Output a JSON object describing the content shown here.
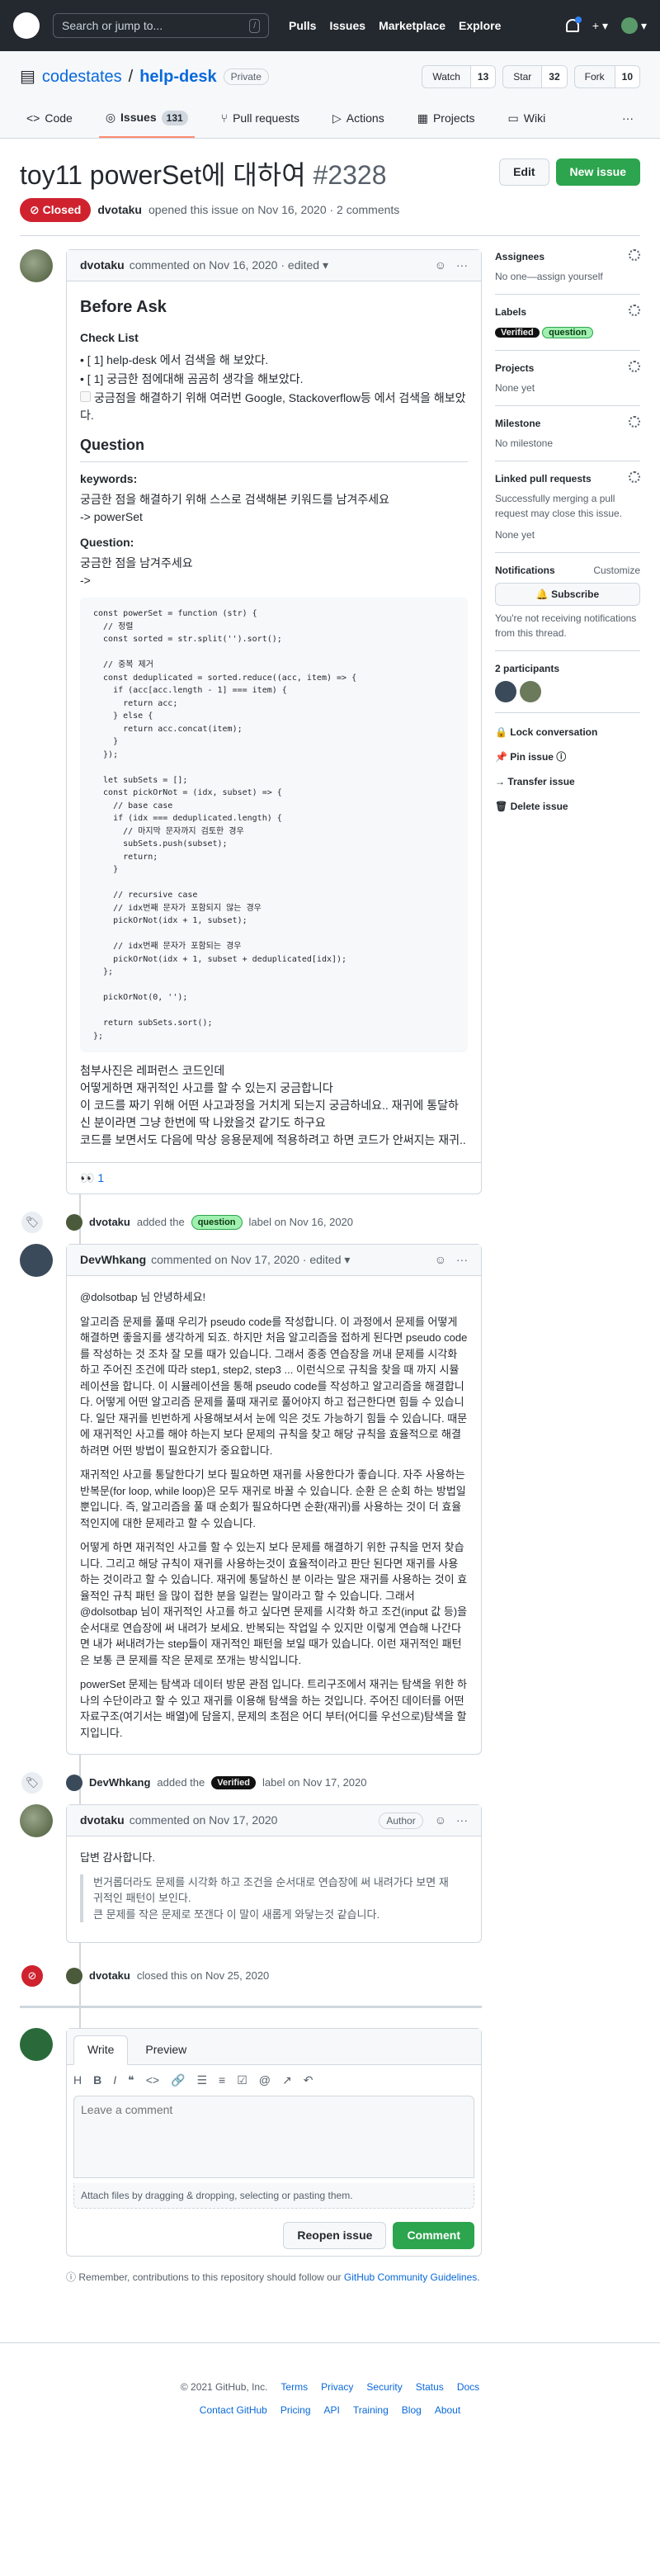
{
  "header": {
    "search_placeholder": "Search or jump to...",
    "search_key": "/",
    "nav": [
      "Pulls",
      "Issues",
      "Marketplace",
      "Explore"
    ],
    "plus": "+ ▾",
    "avatar_caret": "▾"
  },
  "repo": {
    "owner": "codestates",
    "sep": " / ",
    "name": "help-desk",
    "visibility": "Private",
    "watch": "Watch",
    "watch_count": "13",
    "star": "Star",
    "star_count": "32",
    "fork": "Fork",
    "fork_count": "10"
  },
  "tabs": {
    "code": "Code",
    "issues": "Issues",
    "issues_count": "131",
    "pulls": "Pull requests",
    "actions": "Actions",
    "projects": "Projects",
    "wiki": "Wiki",
    "more": "···"
  },
  "issue": {
    "title": "toy11 powerSet에 대하여",
    "number": "#2328",
    "edit": "Edit",
    "new_issue": "New issue",
    "state": "Closed",
    "author": "dvotaku",
    "opened": "opened this issue on Nov 16, 2020 · 2 comments"
  },
  "c1": {
    "author": "dvotaku",
    "meta": "commented on Nov 16, 2020 · edited ▾",
    "h_before": "Before Ask",
    "h_check": "Check List",
    "check1": "[ 1] help-desk 에서 검색을 해 보았다.",
    "check2": "[ 1] 궁금한 점에대해 곰곰히 생각을 해보았다.",
    "check3": "궁금점을 해결하기 위해 여러번 Google, Stackoverflow등 에서 검색을 해보았다.",
    "h_question": "Question",
    "keywords_h": "keywords:",
    "keywords_p1": "궁금한 점을 해결하기 위해 스스로 검색해본 키워드를 남겨주세요",
    "keywords_p2": "-> powerSet",
    "question_h": "Question:",
    "question_p1": "궁금한 점을 남겨주세요",
    "question_p2": "->",
    "code": "const powerSet = function (str) {\n  // 정렬\n  const sorted = str.split('').sort();\n\n  // 중복 제거\n  const deduplicated = sorted.reduce((acc, item) => {\n    if (acc[acc.length - 1] === item) {\n      return acc;\n    } else {\n      return acc.concat(item);\n    }\n  });\n\n  let subSets = [];\n  const pickOrNot = (idx, subset) => {\n    // base case\n    if (idx === deduplicated.length) {\n      // 마지막 문자까지 검토한 경우\n      subSets.push(subset);\n      return;\n    }\n\n    // recursive case\n    // idx번째 문자가 포함되지 않는 경우\n    pickOrNot(idx + 1, subset);\n\n    // idx번째 문자가 포함되는 경우\n    pickOrNot(idx + 1, subset + deduplicated[idx]);\n  };\n\n  pickOrNot(0, '');\n\n  return subSets.sort();\n};",
    "after1": "첨부사진은 레퍼런스 코드인데",
    "after2": "어떻게하면 재귀적인 사고를 할 수 있는지 궁금합니다",
    "after3": "이 코드를 짜기 위해 어떤 사고과정을 거치게 되는지 궁금하네요.. 재귀에 통달하신 분이라면 그냥 한번에 딱 나왔을것 같기도 하구요",
    "after4": "코드를 보면서도 다음에 막상 응용문제에 적용하려고 하면 코드가 안써지는 재귀..",
    "reaction": "👀 1"
  },
  "ev1": {
    "user": "dvotaku",
    "text1": "added the",
    "label": "question",
    "text2": "label on Nov 16, 2020"
  },
  "c2": {
    "author": "DevWhkang",
    "meta": "commented on Nov 17, 2020 · edited ▾",
    "p1": "@dolsotbap 님 안녕하세요!",
    "p2": "알고리즘 문제를 풀때 우리가 pseudo code를 작성합니다. 이 과정에서 문제를 어떻게 해결하면 좋을지를 생각하게 되죠. 하지만 처음 알고리즘을 접하게 된다면 pseudo code를 작성하는 것 조차 잘 모를 때가 있습니다. 그래서 종종 연습장을 꺼내 문제를 시각화 하고 주어진 조건에 따라 step1, step2, step3 ... 이런식으로 규칙을 찾을 때 까지 시뮬레이션을 합니다. 이 시뮬레이션을 통해 pseudo code를 작성하고 알고리즘을 해결합니다. 어떻게 어떤 알고리즘 문제를 풀때 재귀로 풀어야지 하고 접근한다면 힘들 수 있습니다. 일단 재귀를 빈번하게 사용해보셔서 눈에 익은 것도 가능하기 힘들 수 있습니다. 때문에 재귀적인 사고를 해야 하는지 보다 문제의 규칙을 찾고 해당 규칙을 효율적으로 해결하려면 어떤 방법이 필요한지가 중요합니다.",
    "p3": "재귀적인 사고를 통달한다기 보다 필요하면 재귀를 사용한다가 좋습니다. 자주 사용하는 반복문(for loop, while loop)은 모두 재귀로 바꿀 수 있습니다. 순환 은 순회 하는 방법일 뿐입니다. 즉, 알고리즘을 풀 때 순회가 필요하다면 순환(재귀)를 사용하는 것이 더 효율적인지에 대한 문제라고 할 수 있습니다.",
    "p4": "어떻게 하면 재귀적인 사고를 할 수 있는지 보다 문제를 해결하기 위한 규칙을 먼저 찾습니다. 그리고 해당 규칙이 재귀를 사용하는것이 효율적이라고 판단 된다면 재귀를 사용하는 것이라고 할 수 있습니다. 재귀에 통달하신 분 이라는 말은 재귀를 사용하는 것이 효율적인 규칙 패턴 을 많이 접한 분을 일컫는 말이라고 할 수 있습니다. 그래서 @dolsotbap 님이 재귀적인 사고를 하고 싶다면 문제를 시각화 하고 조건(input 값 등)을 순서대로 연습장에 써 내려가 보세요. 반복되는 작업일 수 있지만 이렇게 연습해 나간다면 내가 써내려가는 step들이 재귀적인 패턴을 보일 때가 있습니다. 이런 재귀적인 패턴은 보통 큰 문제를 작은 문제로 쪼개는 방식입니다.",
    "p5": "powerSet 문제는 탐색과 데이터 방문 관점 입니다. 트리구조에서 재귀는 탐색을 위한 하나의 수단이라고 할 수 있고 재귀를 이용해 탐색을 하는 것입니다. 주어진 데이터를 어떤 자료구조(여기서는 배열)에 담을지, 문제의 초점은 어디 부터(어디를 우선으로)탐색을 할 지입니다."
  },
  "ev2": {
    "user": "DevWhkang",
    "text1": "added the",
    "label": "Verified",
    "text2": "label on Nov 17, 2020"
  },
  "c3": {
    "author": "dvotaku",
    "meta": "commented on Nov 17, 2020",
    "badge": "Author",
    "p1": "답변 감사합니다.",
    "q1": "번거롭더라도 문제를 시각화 하고 조건을 순서대로 연습장에 써 내려가다 보면 재귀적인 패턴이 보인다.",
    "q2": "큰 문제를 작은 문제로 쪼갠다 이 말이 새롭게 와닿는것 같습니다."
  },
  "ev3": {
    "user": "dvotaku",
    "text": "closed this on Nov 25, 2020"
  },
  "editor": {
    "write": "Write",
    "preview": "Preview",
    "placeholder": "Leave a comment",
    "attach": "Attach files by dragging & dropping, selecting or pasting them.",
    "reopen": "Reopen issue",
    "comment": "Comment",
    "note1": "Remember, contributions to this repository should follow our",
    "note_link": "GitHub Community Guidelines",
    "note2": "."
  },
  "sidebar": {
    "assignees": "Assignees",
    "assignees_v": "No one—assign yourself",
    "labels": "Labels",
    "label1": "Verified",
    "label2": "question",
    "projects": "Projects",
    "projects_v": "None yet",
    "milestone": "Milestone",
    "milestone_v": "No milestone",
    "linked": "Linked pull requests",
    "linked_v": "Successfully merging a pull request may close this issue.",
    "linked_v2": "None yet",
    "notifications": "Notifications",
    "customize": "Customize",
    "subscribe": "🔔 Subscribe",
    "notif_v": "You're not receiving notifications from this thread.",
    "participants": "2 participants",
    "lock": "🔒 Lock conversation",
    "pin": "📌 Pin issue ⓘ",
    "transfer": "→ Transfer issue",
    "delete": "🗑 Delete issue"
  },
  "footer": {
    "copy": "© 2021 GitHub, Inc.",
    "l1": [
      "Terms",
      "Privacy",
      "Security",
      "Status",
      "Docs"
    ],
    "l2": [
      "Contact GitHub",
      "Pricing",
      "API",
      "Training",
      "Blog",
      "About"
    ]
  }
}
